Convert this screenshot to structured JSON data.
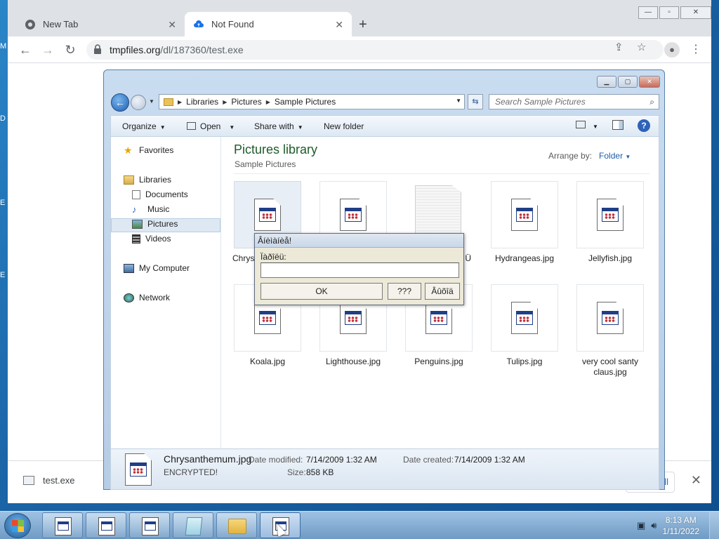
{
  "desktop": {
    "edge_letters": [
      "M",
      "D",
      "E",
      "E"
    ]
  },
  "browser": {
    "tabs": [
      {
        "title": "New Tab",
        "icon": "chrome-icon"
      },
      {
        "title": "Not Found",
        "icon": "cloud-upload-icon"
      }
    ],
    "url": {
      "host": "tmpfiles.org",
      "path": "/dl/187360/test.exe"
    },
    "download": {
      "filename": "test.exe",
      "show_all": "all"
    }
  },
  "explorer": {
    "address": [
      "Libraries",
      "Pictures",
      "Sample Pictures"
    ],
    "search_placeholder": "Search Sample Pictures",
    "commands": {
      "organize": "Organize",
      "open": "Open",
      "share": "Share with",
      "new_folder": "New folder"
    },
    "nav": {
      "favorites": "Favorites",
      "libraries": "Libraries",
      "documents": "Documents",
      "music": "Music",
      "pictures": "Pictures",
      "videos": "Videos",
      "computer": "My Computer",
      "network": "Network"
    },
    "library_title": "Pictures library",
    "library_sub": "Sample Pictures",
    "arrange_label": "Arrange by:",
    "arrange_value": "Folder",
    "files": [
      {
        "name": "Chrys",
        "kind": "exe"
      },
      {
        "name": "",
        "kind": "exe"
      },
      {
        "name": "Ü",
        "kind": "doc"
      },
      {
        "name": "Hydrangeas.jpg",
        "kind": "exe"
      },
      {
        "name": "Jellyfish.jpg",
        "kind": "exe"
      },
      {
        "name": "Koala.jpg",
        "kind": "exe"
      },
      {
        "name": "Lighthouse.jpg",
        "kind": "exe"
      },
      {
        "name": "Penguins.jpg",
        "kind": "exe"
      },
      {
        "name": "Tulips.jpg",
        "kind": "exe"
      },
      {
        "name": "very cool santy claus.jpg",
        "kind": "exe"
      }
    ],
    "details": {
      "name": "Chrysanthemum.jpg",
      "status": "ENCRYPTED!",
      "modified_label": "Date modified:",
      "modified_value": "7/14/2009 1:32 AM",
      "created_label": "Date created:",
      "created_value": "7/14/2009 1:32 AM",
      "size_label": "Size:",
      "size_value": "858 KB"
    }
  },
  "dialog": {
    "title": "Âíèìàíèå!",
    "label": "Ïàðîëü:",
    "input_value": "",
    "ok": "OK",
    "btn2": "???",
    "btn3": "Âûõîä"
  },
  "taskbar": {
    "time": "8:13 AM",
    "date": "1/11/2022"
  }
}
